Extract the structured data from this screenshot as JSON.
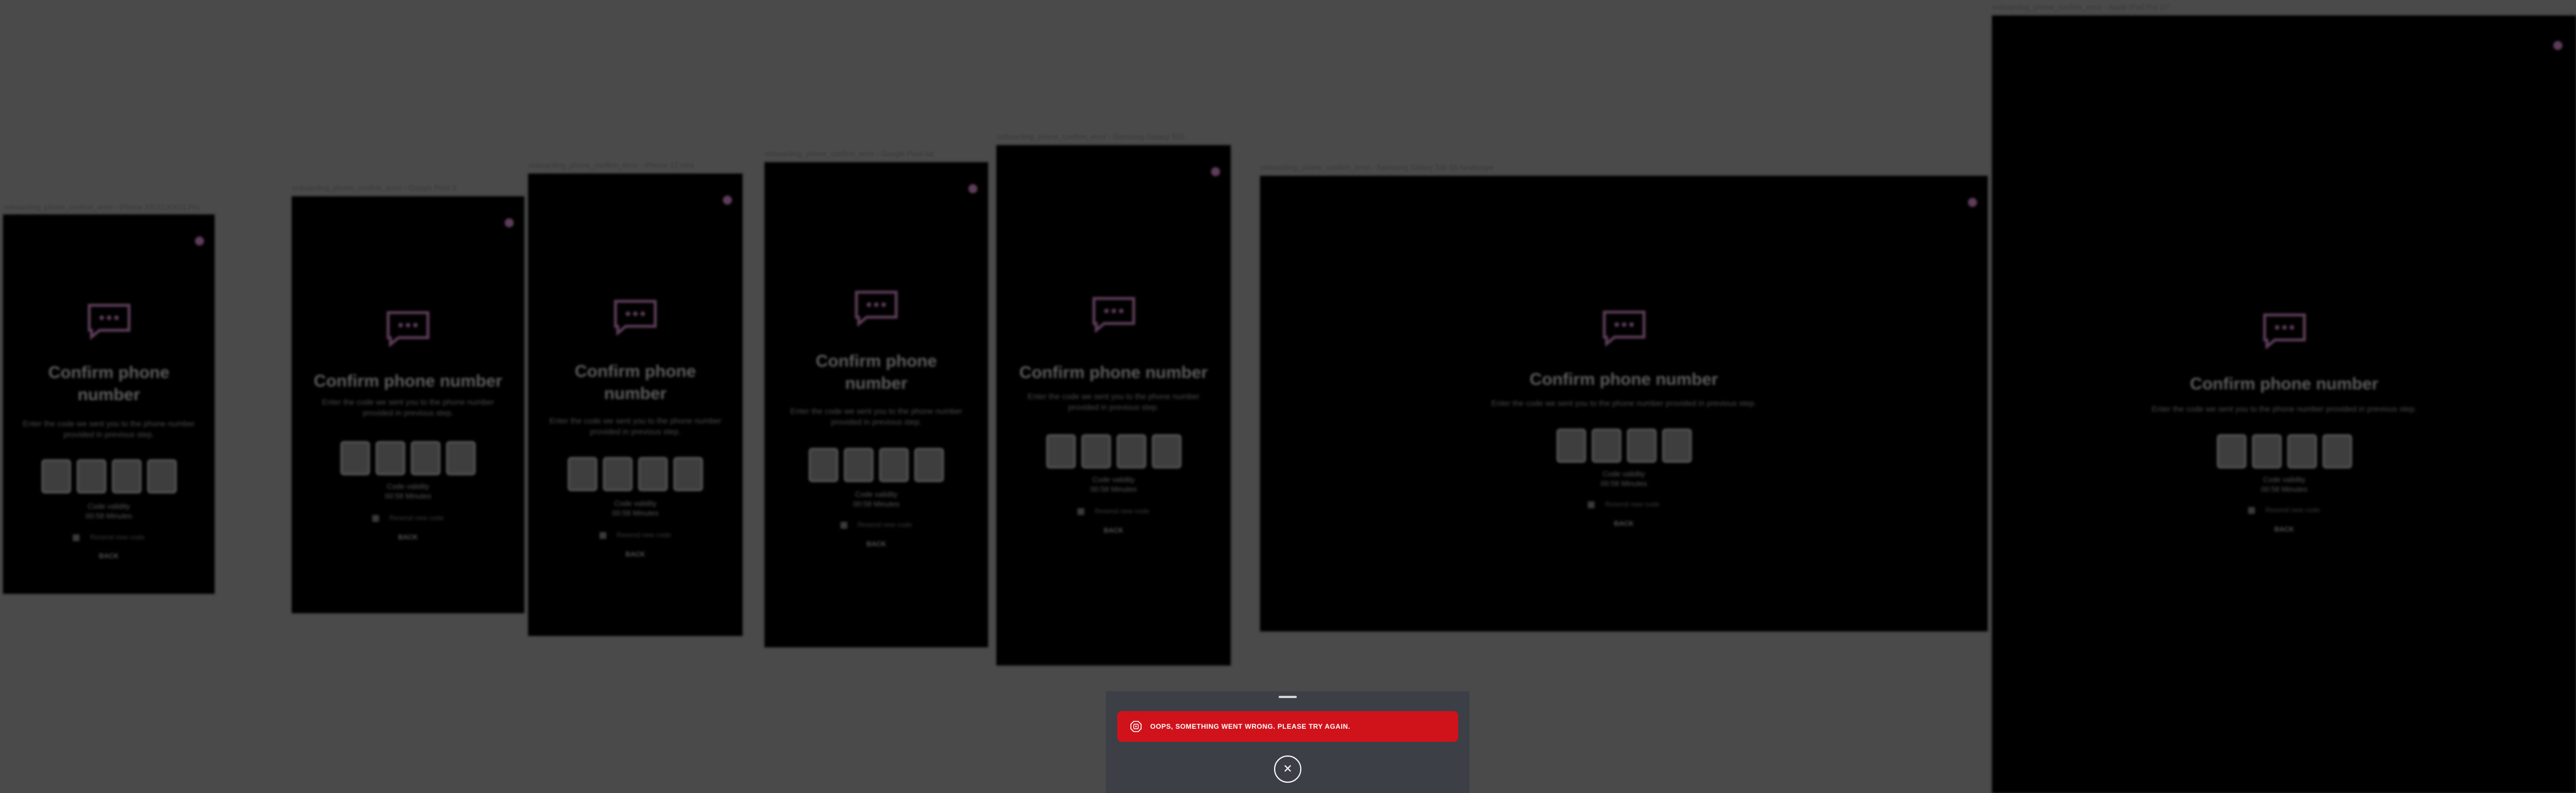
{
  "screen": {
    "title": "Confirm phone number",
    "subtitle": "Enter the code we sent you to the phone number provided in previous step.",
    "code_valid_label": "Code validity",
    "code_valid_time": "00:58 Minutes",
    "resend_label": "Resend new code",
    "back_label": "BACK"
  },
  "frames": [
    {
      "label": "onboarding_phone_confirm_error - iPhone XR/11/XS/11 Pro"
    },
    {
      "label": "onboarding_phone_confirm_error - Google Pixel 5"
    },
    {
      "label": "onboarding_phone_confirm_error - iPhone 12 mini"
    },
    {
      "label": "onboarding_phone_confirm_error - Google Pixel 4a"
    },
    {
      "label": "onboarding_phone_confirm_error - Samsung Galaxy S20"
    },
    {
      "label": "onboarding_phone_confirm_error - Samsung Galaxy Tab S6 landscape"
    },
    {
      "label": "onboarding_phone_confirm_error - Apple iPad Pro 11\""
    }
  ],
  "sheet": {
    "error_message": "OOPS, SOMETHING WENT WRONG. PLEASE TRY AGAIN.",
    "close_icon": "close-icon",
    "error_icon": "error-icon"
  },
  "colors": {
    "error_red": "#d0121b",
    "sheet_bg": "#3c3f46",
    "overlay": "#4a4a4a",
    "accent_purple": "#5e3d5a"
  }
}
